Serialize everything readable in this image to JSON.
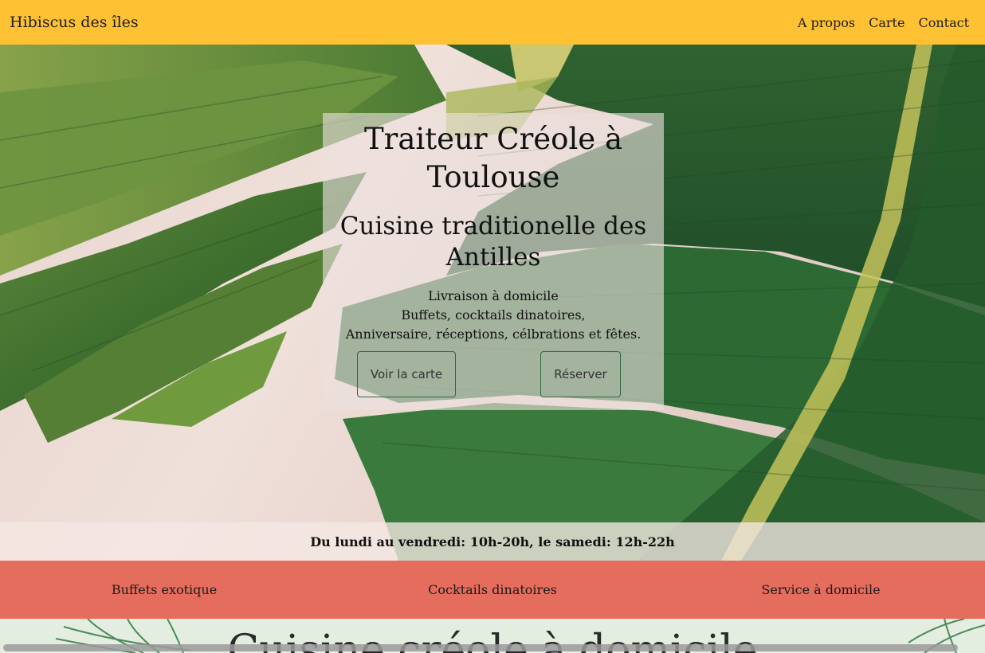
{
  "header": {
    "brand": "Hibiscus des îles",
    "nav": [
      "A propos",
      "Carte",
      "Contact"
    ]
  },
  "hero": {
    "title": "Traiteur Créole à Toulouse",
    "subtitle": "Cuisine traditionelle des Antilles",
    "lines": [
      "Livraison à domicile",
      "Buffets, cocktails dinatoires,",
      "Anniversaire, réceptions, célbrations et fêtes."
    ],
    "buttons": {
      "menu": "Voir la carte",
      "book": "Réserver"
    },
    "hours": "Du lundi au vendredi: 10h-20h, le samedi: 12h-22h"
  },
  "services": [
    "Buffets exotique",
    "Cocktails dinatoires",
    "Service à domicile"
  ],
  "next_section": {
    "title": "Cuisine créole à domicile"
  },
  "colors": {
    "header": "#fec133",
    "services": "#e56d5d",
    "button_border": "#2c6a43",
    "next_bg": "#e3eee1"
  }
}
